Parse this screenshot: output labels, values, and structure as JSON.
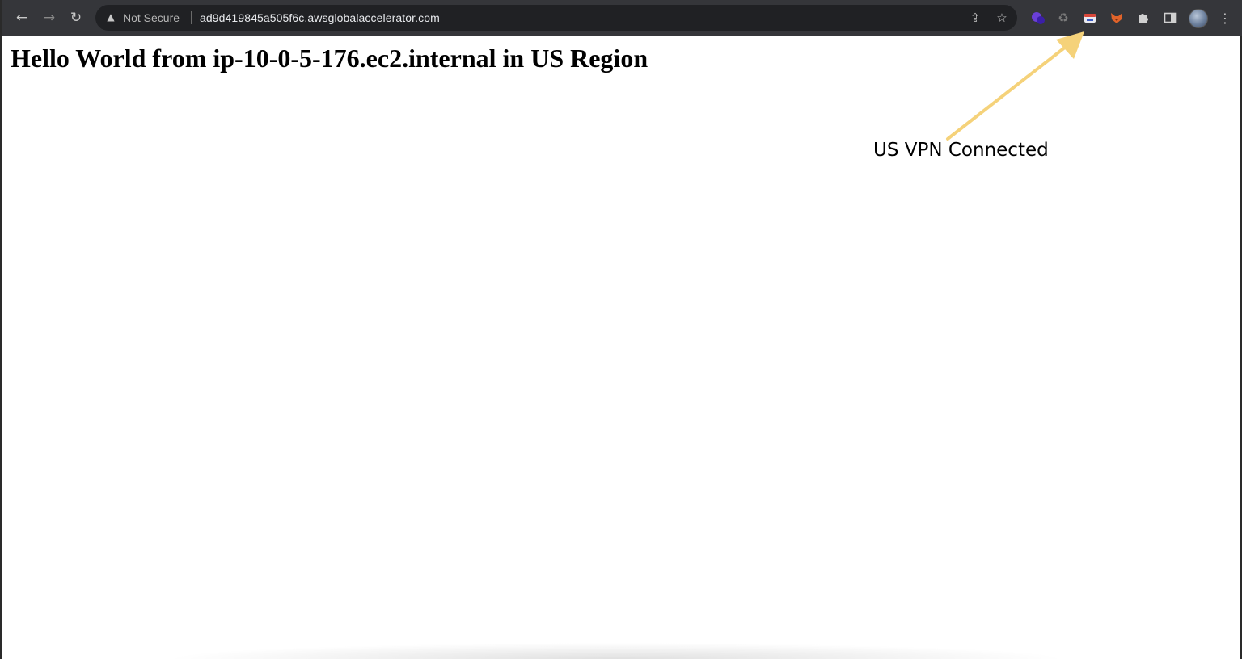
{
  "browser": {
    "security_label": "Not Secure",
    "url": "ad9d419845a505f6c.awsglobalaccelerator.com",
    "icons": {
      "back": "back-arrow-icon",
      "forward": "forward-arrow-icon",
      "reload": "reload-icon",
      "warning": "warning-icon",
      "share": "share-icon",
      "bookmark": "star-icon",
      "extensions": [
        "purple-extension-icon",
        "recycle-extension-icon",
        "vpn-extension-icon",
        "fox-extension-icon",
        "puzzle-icon",
        "side-panel-icon"
      ],
      "profile": "avatar",
      "menu": "kebab-menu-icon"
    },
    "colors": {
      "toolbar": "#35363a",
      "omnibox": "#202124"
    }
  },
  "page": {
    "heading": "Hello World from ip-10-0-5-176.ec2.internal in US Region"
  },
  "annotation": {
    "label": "US VPN Connected",
    "arrow_color": "#f5d27a"
  }
}
